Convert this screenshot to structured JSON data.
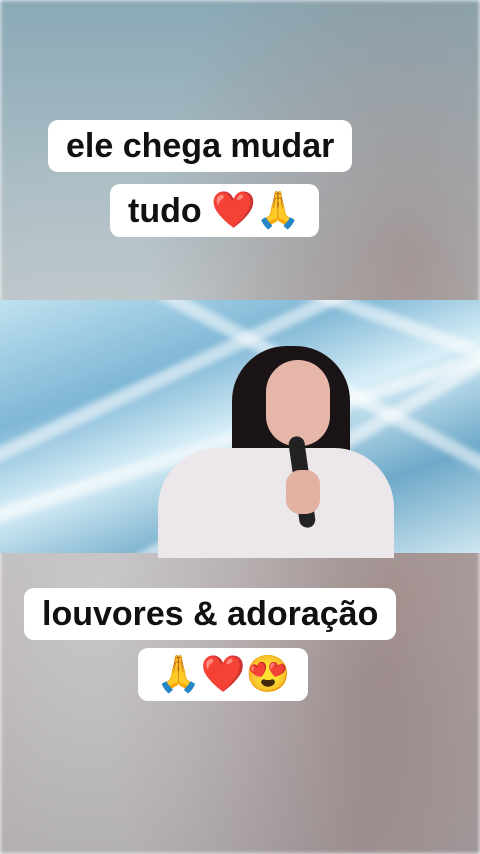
{
  "captions": {
    "top": {
      "line1": "ele chega mudar",
      "line2_text": "tudo ",
      "line2_emoji": "❤️🙏"
    },
    "bottom": {
      "line1": "louvores & adoração",
      "line2_emoji": "🙏❤️😍"
    }
  },
  "colors": {
    "caption_bg": "#ffffff",
    "caption_text": "#111111"
  },
  "video": {
    "subject": "singer-with-microphone"
  }
}
